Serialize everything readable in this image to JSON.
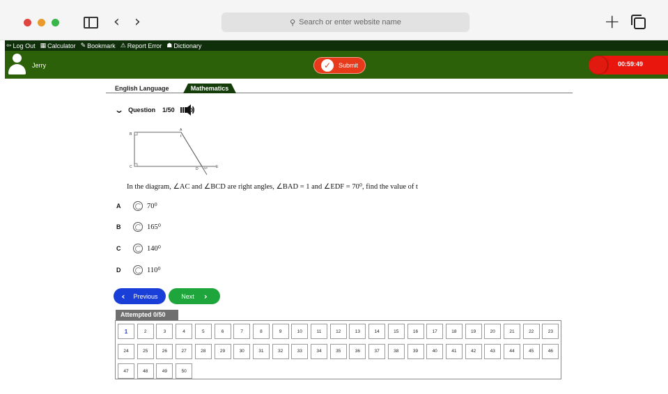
{
  "browser": {
    "address_placeholder": "Search or enter website name",
    "icons": [
      "sidebar-icon",
      "back-arrow-icon",
      "forward-arrow-icon",
      "search-icon",
      "new-tab-icon",
      "tabs-overview-icon"
    ]
  },
  "menu": {
    "items": [
      {
        "label": "Log Out",
        "icon": "logout-icon",
        "glyph": "⇦"
      },
      {
        "label": "Calculator",
        "icon": "calculator-icon",
        "glyph": "▦"
      },
      {
        "label": "Bookmark",
        "icon": "bookmark-icon",
        "glyph": "✎"
      },
      {
        "label": "Report Error",
        "icon": "warning-icon",
        "glyph": "⚠"
      },
      {
        "label": "Dictionary",
        "icon": "dictionary-icon",
        "glyph": "☗"
      }
    ]
  },
  "user": {
    "name": "Jerry"
  },
  "submit": {
    "label": "Submit"
  },
  "timer": {
    "value": "00:59:49"
  },
  "subjects": {
    "english": "English Language",
    "math": "Mathematics"
  },
  "question": {
    "label": "Question",
    "number": "1/50",
    "text": "In the diagram, ∠AC and ∠BCD are right angles, ∠BAD = 1 and ∠EDF = 70⁰, find the value of t",
    "diagram_labels": {
      "a": "A",
      "b": "B",
      "c": "C",
      "d": "D",
      "e": "E",
      "t": "t",
      "angle": "70⁰"
    }
  },
  "options": [
    {
      "letter": "A",
      "value": "70⁰"
    },
    {
      "letter": "B",
      "value": "165⁰"
    },
    {
      "letter": "C",
      "value": "140⁰"
    },
    {
      "letter": "D",
      "value": "110⁰"
    }
  ],
  "navigation": {
    "previous": "Previous",
    "next": "Next"
  },
  "attempted": {
    "label": "Attempted 0/50"
  },
  "question_grid": [
    "1",
    "2",
    "3",
    "4",
    "5",
    "6",
    "7",
    "8",
    "9",
    "10",
    "11",
    "12",
    "13",
    "14",
    "15",
    "16",
    "17",
    "18",
    "19",
    "20",
    "21",
    "22",
    "23",
    "24",
    "25",
    "26",
    "27",
    "28",
    "29",
    "30",
    "31",
    "32",
    "33",
    "34",
    "35",
    "36",
    "37",
    "38",
    "39",
    "40",
    "41",
    "42",
    "43",
    "44",
    "45",
    "46",
    "47",
    "48",
    "49",
    "50"
  ],
  "current_question": "1",
  "colors": {
    "header_dark": "#0e2f0a",
    "header_green": "#2c6009",
    "submit_red": "#e8391b",
    "timer_red": "#e8160d",
    "prev_blue": "#1a3fd8",
    "next_green": "#1ea53c"
  }
}
